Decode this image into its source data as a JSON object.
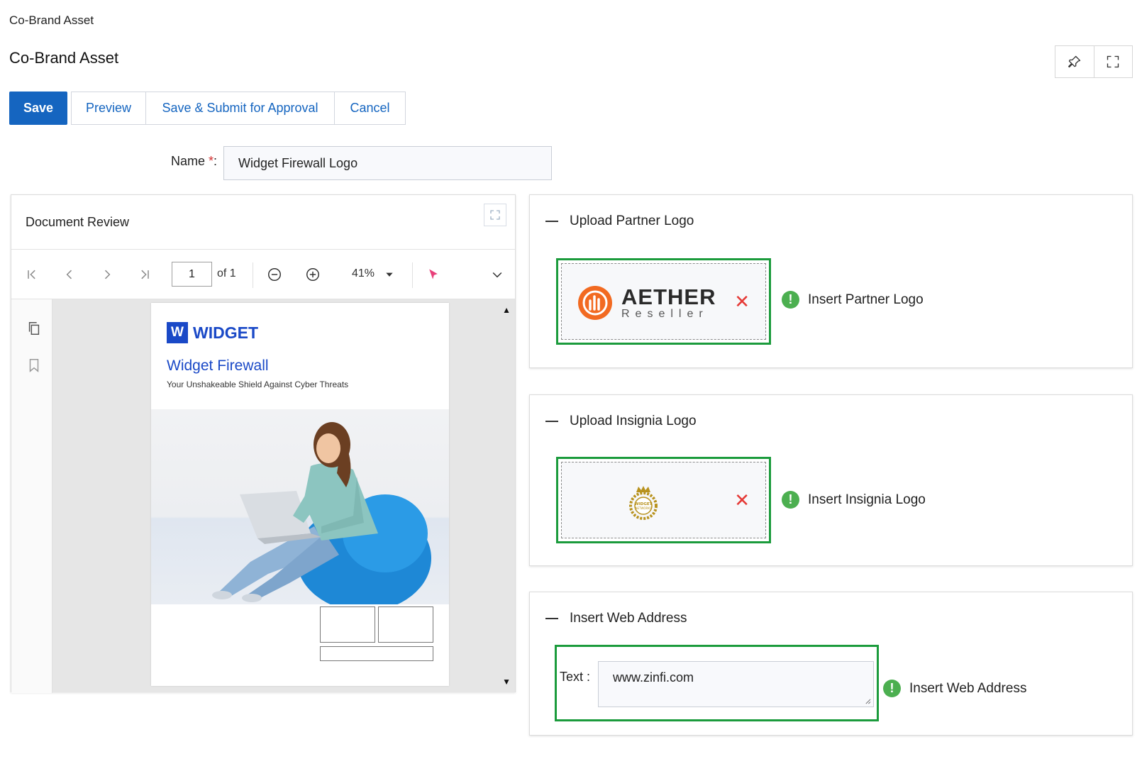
{
  "breadcrumb": "Co-Brand Asset",
  "page_title": "Co-Brand Asset",
  "actions": {
    "save": "Save",
    "preview": "Preview",
    "save_submit": "Save & Submit for Approval",
    "cancel": "Cancel"
  },
  "name_field": {
    "label": "Name",
    "required_mark": "*",
    "colon": ":",
    "value": "Widget Firewall Logo"
  },
  "document_review": {
    "title": "Document Review",
    "current_page": "1",
    "of_pages": "of 1",
    "zoom": "41%",
    "page": {
      "brand_mark": "W",
      "brand_name": "WIDGET",
      "product_title": "Widget Firewall",
      "product_subtitle": "Your Unshakeable Shield Against Cyber Threats"
    }
  },
  "partner_logo": {
    "title": "Upload Partner Logo",
    "logo_name": "AETHER",
    "logo_sub": "Reseller",
    "hint": "Insert Partner Logo"
  },
  "insignia_logo": {
    "title": "Upload Insignia Logo",
    "seal_text_top": "WIDGET",
    "seal_text_bottom": "NETWORKS",
    "hint": "Insert Insignia Logo"
  },
  "web_address": {
    "title": "Insert Web Address",
    "label": "Text :",
    "value": "www.zinfi.com",
    "hint": "Insert Web Address"
  },
  "colors": {
    "primary": "#1565c0",
    "brand_blue": "#1a49c7",
    "frame_green": "#1b9b3c",
    "remove_red": "#e53935",
    "warn_green": "#4caf50",
    "aether_orange": "#f26a21",
    "seal_gold": "#b8921d"
  }
}
